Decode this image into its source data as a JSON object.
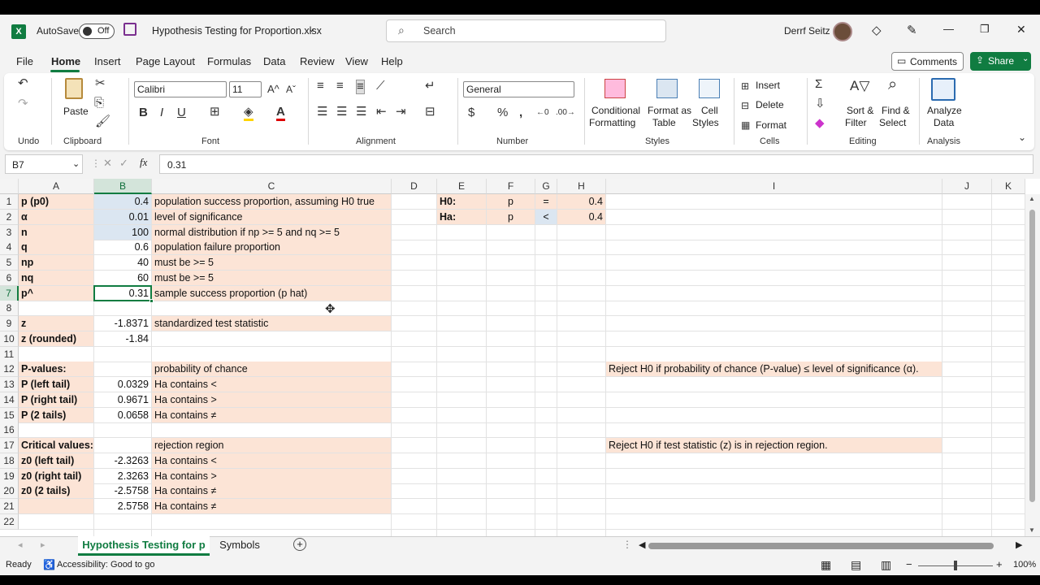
{
  "titlebar": {
    "autosave_label": "AutoSave",
    "autosave_state": "Off",
    "filename": "Hypothesis Testing for Proportion.xlsx",
    "search_placeholder": "Search",
    "user_name": "Derrf Seitz",
    "minimize": "—",
    "restore": "❐",
    "close": "✕"
  },
  "menu": {
    "items": [
      "File",
      "Home",
      "Insert",
      "Page Layout",
      "Formulas",
      "Data",
      "Review",
      "View",
      "Help"
    ],
    "comments_label": "Comments",
    "share_label": "Share"
  },
  "ribbon": {
    "groups": [
      "Undo",
      "Clipboard",
      "Font",
      "Alignment",
      "Number",
      "Styles",
      "Cells",
      "Editing",
      "Analysis"
    ],
    "paste": "Paste",
    "font_name": "Calibri",
    "font_size": "11",
    "number_format": "General",
    "conditional_formatting": [
      "Conditional",
      "Formatting"
    ],
    "format_as_table": [
      "Format as",
      "Table"
    ],
    "cell_styles": [
      "Cell",
      "Styles"
    ],
    "insert": "Insert",
    "delete": "Delete",
    "format": "Format",
    "sort_filter": [
      "Sort &",
      "Filter"
    ],
    "find_select": [
      "Find &",
      "Select"
    ],
    "analyze_data": [
      "Analyze",
      "Data"
    ]
  },
  "formula_bar": {
    "name_box": "B7",
    "fx": "fx",
    "content": "0.31"
  },
  "columns": [
    "A",
    "B",
    "C",
    "D",
    "E",
    "F",
    "G",
    "H",
    "I",
    "J",
    "K"
  ],
  "rows": [
    "1",
    "2",
    "3",
    "4",
    "5",
    "6",
    "7",
    "8",
    "9",
    "10",
    "11",
    "12",
    "13",
    "14",
    "15",
    "16",
    "17",
    "18",
    "19",
    "20",
    "21",
    "22"
  ],
  "cells": {
    "A1": "p (p0)",
    "B1": "0.4",
    "C1": "population success proportion, assuming H0 true",
    "A2": "α",
    "B2": "0.01",
    "C2": "level of significance",
    "A3": "n",
    "B3": "100",
    "C3": "normal distribution if np >= 5 and nq >= 5",
    "A4": "q",
    "B4": "0.6",
    "C4": "population failure proportion",
    "A5": "np",
    "B5": "40",
    "C5": "must be >= 5",
    "A6": "nq",
    "B6": "60",
    "C6": "must be >= 5",
    "A7": "p^",
    "B7": "0.31",
    "C7": "sample success proportion (p hat)",
    "A9": "z",
    "B9": "-1.8371",
    "C9": "standardized test statistic",
    "A10": "z (rounded)",
    "B10": "-1.84",
    "A12": "P-values:",
    "C12": "probability of chance",
    "A13": "P (left tail)",
    "B13": "0.0329",
    "C13": "Ha contains <",
    "A14": "P (right tail)",
    "B14": "0.9671",
    "C14": "Ha contains >",
    "A15": "P (2 tails)",
    "B15": "0.0658",
    "C15": "Ha contains ≠",
    "A17": "Critical values:",
    "C17": "rejection region",
    "A18": "z0 (left tail)",
    "B18": "-2.3263",
    "C18": "Ha contains <",
    "A19": "z0 (right tail)",
    "B19": "2.3263",
    "C19": "Ha contains >",
    "A20": "z0 (2 tails)",
    "B20": "-2.5758",
    "C20": "Ha contains ≠",
    "B21": "2.5758",
    "C21": "Ha contains ≠",
    "E1": "H0:",
    "F1": "p",
    "G1": "=",
    "H1": "0.4",
    "E2": "Ha:",
    "F2": "p",
    "G2": "<",
    "H2": "0.4",
    "I12": "Reject H0 if probability of chance (P-value) ≤ level of significance (α).",
    "I17": "Reject H0 if test statistic (z) is in rejection region."
  },
  "sheet_tabs": [
    "Hypothesis Testing for p",
    "Symbols"
  ],
  "status": {
    "ready": "Ready",
    "accessibility": "Accessibility: Good to go",
    "zoom": "100%"
  },
  "colors": {
    "excel_green": "#107c41",
    "peach_fill": "#fce4d6",
    "blue_fill": "#dbe6f1"
  }
}
